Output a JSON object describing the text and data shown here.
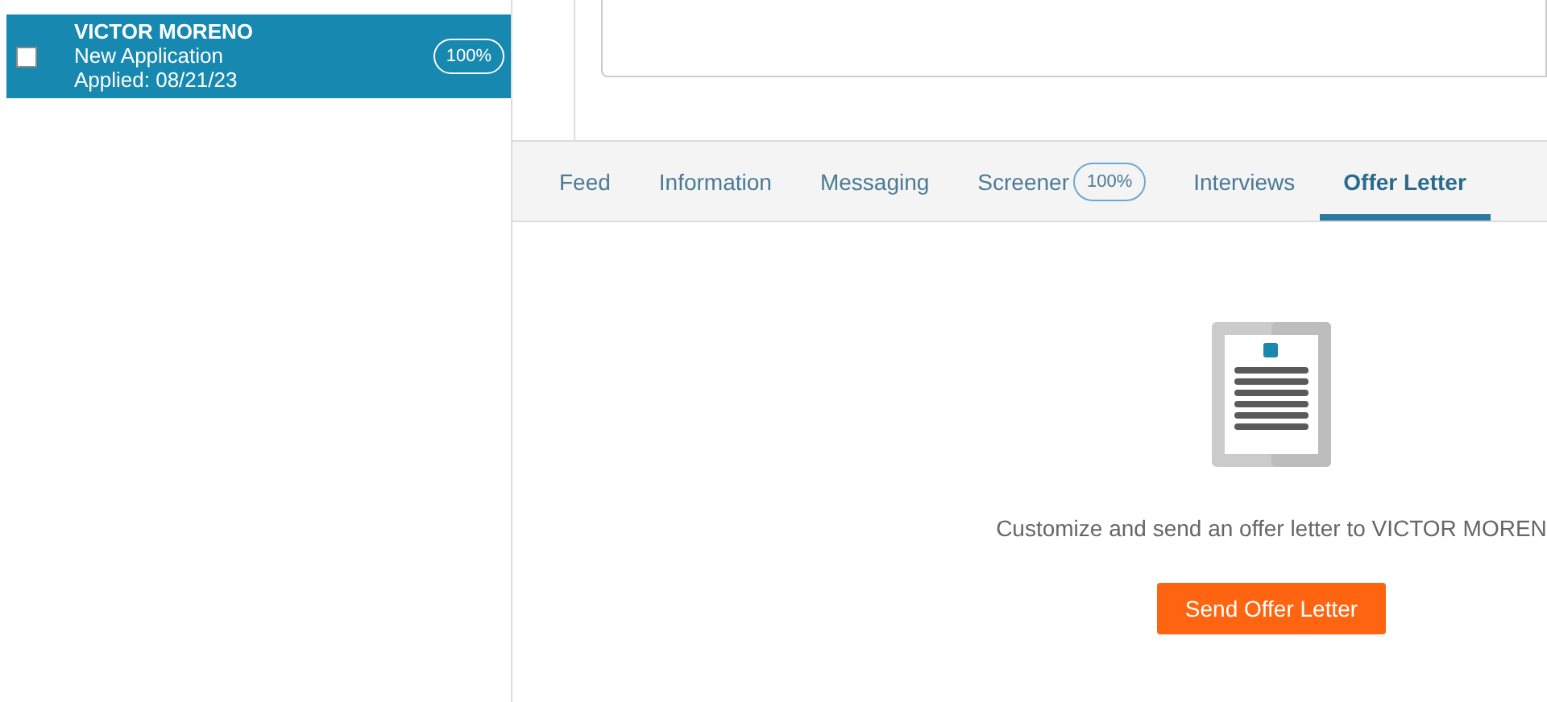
{
  "candidates": [
    {
      "name": "VICTOR MORENO",
      "status": "New Application",
      "applied": "Applied: 08/21/23",
      "score": "100%",
      "checked": false,
      "selected": true
    }
  ],
  "tabs": [
    {
      "label": "Feed",
      "selected": false
    },
    {
      "label": "Information",
      "selected": false
    },
    {
      "label": "Messaging",
      "selected": false
    },
    {
      "label": "Screener",
      "badge": "100%",
      "selected": false
    },
    {
      "label": "Interviews",
      "selected": false
    },
    {
      "label": "Offer Letter",
      "selected": true
    }
  ],
  "offer_letter": {
    "message": "Customize and send an offer letter to VICTOR MOREN",
    "button": "Send Offer Letter"
  }
}
